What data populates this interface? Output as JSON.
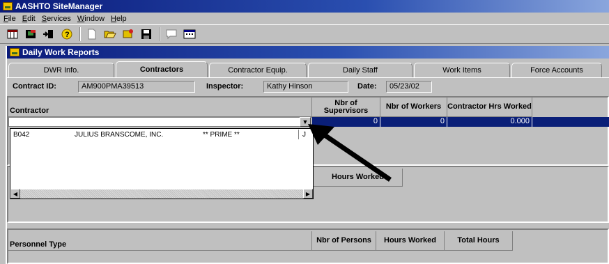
{
  "app": {
    "title": "AASHTO SiteManager"
  },
  "menu": [
    "File",
    "Edit",
    "Services",
    "Window",
    "Help"
  ],
  "toolbar": {
    "icons": [
      "grid-icon",
      "flag-icon",
      "arrow-door-icon",
      "help-icon",
      "new-doc-icon",
      "open-folder-icon",
      "wizard-icon",
      "save-icon",
      "comment-icon",
      "calendar-icon"
    ]
  },
  "window": {
    "title": "Daily Work Reports"
  },
  "tabs": [
    "DWR Info.",
    "Contractors",
    "Contractor Equip.",
    "Daily Staff",
    "Work Items",
    "Force Accounts"
  ],
  "active_tab": "Contractors",
  "info": {
    "contract_label": "Contract ID:",
    "contract_value": "AM900PMA39513",
    "inspector_label": "Inspector:",
    "inspector_value": "Kathy Hinson",
    "date_label": "Date:",
    "date_value": "05/23/02"
  },
  "contractor_grid": {
    "headers": {
      "contractor": "Contractor",
      "supervisors": "Nbr of Supervisors",
      "workers": "Nbr of Workers",
      "hrs": "Contractor Hrs Worked"
    },
    "row": {
      "supervisors": "0",
      "workers": "0",
      "hrs": "0.000"
    }
  },
  "dropdown": {
    "code": "B042",
    "name": "JULIUS BRANSCOME, INC.",
    "flag": "** PRIME **",
    "extra": "J"
  },
  "hours_grid": {
    "header": "Hours Worked"
  },
  "personnel_grid": {
    "headers": {
      "type": "Personnel Type",
      "persons": "Nbr of Persons",
      "hours": "Hours Worked",
      "total": "Total Hours"
    }
  }
}
